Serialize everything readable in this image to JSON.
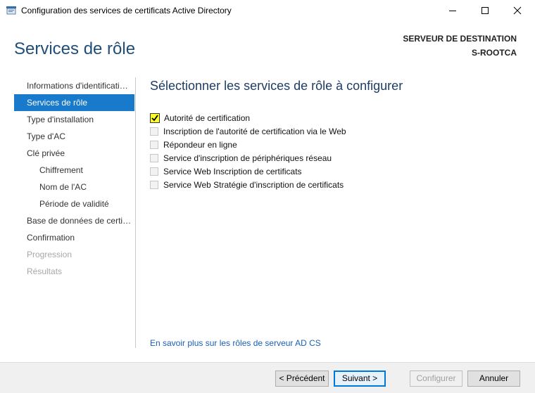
{
  "window": {
    "title": "Configuration des services de certificats Active Directory",
    "icon": "server-manager-icon",
    "controls": [
      "minimize-icon",
      "maximize-icon",
      "close-icon"
    ]
  },
  "header": {
    "page_title": "Services de rôle",
    "destination_label": "SERVEUR DE DESTINATION",
    "destination_server": "S-ROOTCA"
  },
  "nav": {
    "items": [
      {
        "label": "Informations d'identificati…",
        "state": "normal"
      },
      {
        "label": "Services de rôle",
        "state": "active"
      },
      {
        "label": "Type d'installation",
        "state": "normal"
      },
      {
        "label": "Type d'AC",
        "state": "normal"
      },
      {
        "label": "Clé privée",
        "state": "normal"
      },
      {
        "label": "Chiffrement",
        "state": "sub"
      },
      {
        "label": "Nom de l'AC",
        "state": "sub"
      },
      {
        "label": "Période de validité",
        "state": "sub"
      },
      {
        "label": "Base de données de certi…",
        "state": "normal"
      },
      {
        "label": "Confirmation",
        "state": "normal"
      },
      {
        "label": "Progression",
        "state": "disabled"
      },
      {
        "label": "Résultats",
        "state": "disabled"
      }
    ]
  },
  "main": {
    "section_title": "Sélectionner les services de rôle à configurer",
    "options": [
      {
        "label": "Autorité de certification",
        "checked": true
      },
      {
        "label": "Inscription de l'autorité de certification via le Web",
        "checked": false
      },
      {
        "label": "Répondeur en ligne",
        "checked": false
      },
      {
        "label": "Service d'inscription de périphériques réseau",
        "checked": false
      },
      {
        "label": "Service Web Inscription de certificats",
        "checked": false
      },
      {
        "label": "Service Web Stratégie d'inscription de certificats",
        "checked": false
      }
    ],
    "learn_more": "En savoir plus sur les rôles de serveur AD CS"
  },
  "footer": {
    "previous": "< Précédent",
    "next": "Suivant >",
    "configure": "Configurer",
    "cancel": "Annuler"
  },
  "colors": {
    "accent": "#1979ca",
    "title": "#1f4e79",
    "highlight": "#ffff29",
    "link": "#1a5fb4"
  }
}
